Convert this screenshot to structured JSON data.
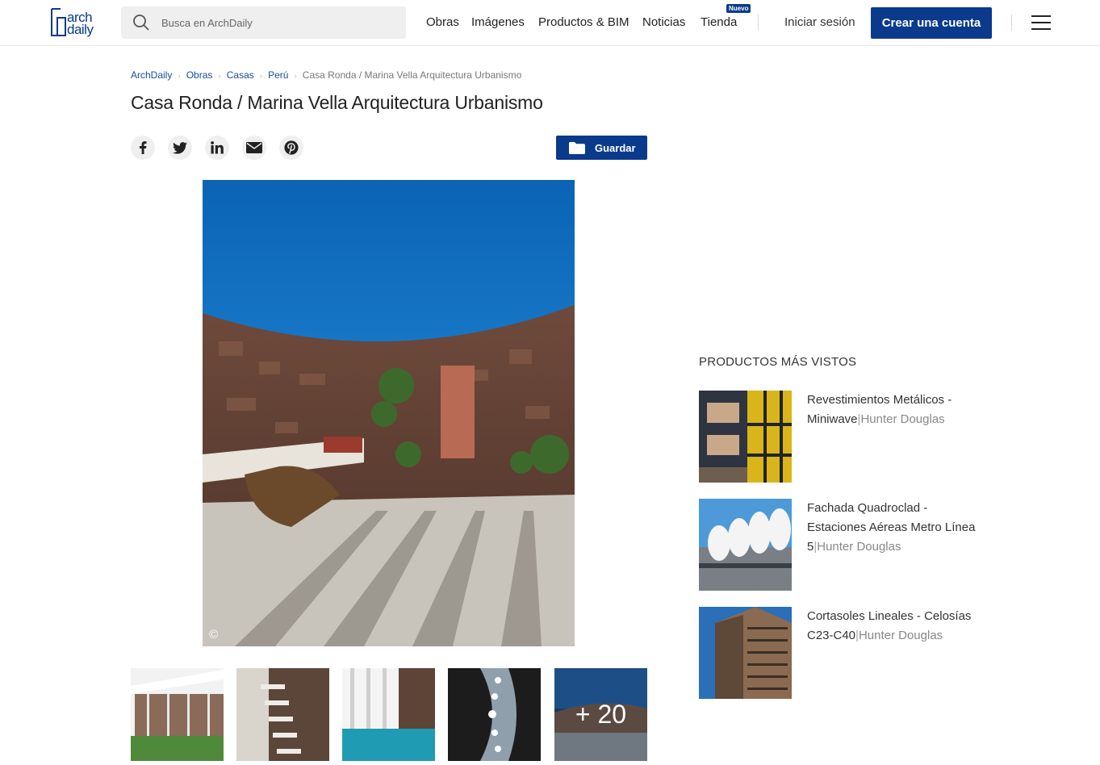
{
  "header": {
    "logo_line1": "arch",
    "logo_line2": "daily",
    "search_placeholder": "Busca en ArchDaily",
    "nav": [
      "Obras",
      "Imágenes",
      "Productos & BIM",
      "Noticias",
      "Tienda"
    ],
    "new_badge": "Nuevo",
    "login": "Iniciar sesión",
    "create_account": "Crear una cuenta"
  },
  "breadcrumb": [
    "ArchDaily",
    "Obras",
    "Casas",
    "Perú"
  ],
  "breadcrumb_current": "Casa Ronda / Marina Vella Arquitectura Urbanismo",
  "title": "Casa Ronda / Marina Vella Arquitectura Urbanismo",
  "share_icons": [
    "facebook-icon",
    "twitter-icon",
    "linkedin-icon",
    "mail-icon",
    "pinterest-icon"
  ],
  "save_label": "Guardar",
  "main_image_copyright": "©",
  "thumbs_more": "+ 20",
  "sidebar": {
    "heading": "PRODUCTOS MÁS VISTOS",
    "products": [
      {
        "name": "Revestimientos Metálicos - Miniwave",
        "brand": "Hunter Douglas"
      },
      {
        "name": "Fachada Quadroclad - Estaciones Aéreas Metro Línea 5",
        "brand": "Hunter Douglas"
      },
      {
        "name": "Cortasoles Lineales - Celosías C23-C40",
        "brand": "Hunter Douglas"
      }
    ]
  },
  "colors": {
    "brand_blue": "#0a3a8c",
    "link_blue": "#1a4a9a"
  }
}
